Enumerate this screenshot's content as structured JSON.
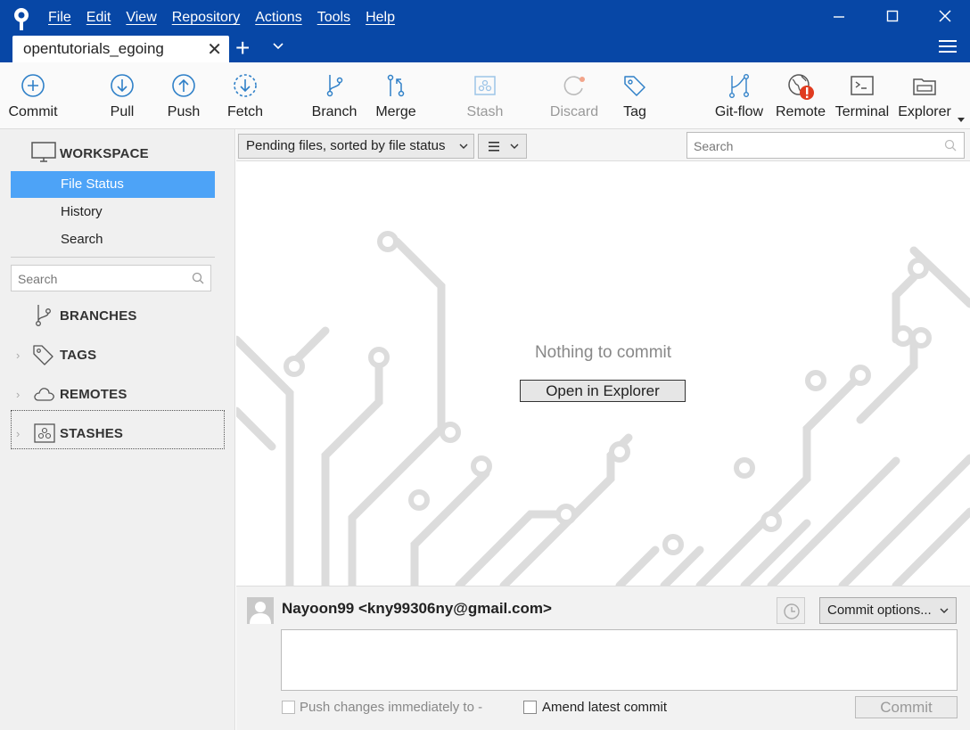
{
  "menu": [
    "File",
    "Edit",
    "View",
    "Repository",
    "Actions",
    "Tools",
    "Help"
  ],
  "window": {
    "minimize": "—",
    "maximize": "☐",
    "close": "✕"
  },
  "tab": {
    "title": "opentutorials_egoing",
    "close": "✕",
    "new": "+"
  },
  "toolbar": {
    "commit": "Commit",
    "pull": "Pull",
    "push": "Push",
    "fetch": "Fetch",
    "branch": "Branch",
    "merge": "Merge",
    "stash": "Stash",
    "discard": "Discard",
    "tag": "Tag",
    "gitflow": "Git-flow",
    "remote": "Remote",
    "terminal": "Terminal",
    "explorer": "Explorer"
  },
  "sidebar": {
    "workspace": "WORKSPACE",
    "items": [
      "File Status",
      "History",
      "Search"
    ],
    "search_placeholder": "Search",
    "branches": "BRANCHES",
    "tags": "TAGS",
    "remotes": "REMOTES",
    "stashes": "STASHES"
  },
  "main": {
    "pending": "Pending files, sorted by file status",
    "search_placeholder": "Search",
    "empty_message": "Nothing to commit",
    "open_explorer": "Open in Explorer"
  },
  "commit_panel": {
    "author": "Nayoon99  <kny99306ny@gmail.com>",
    "options": "Commit options...",
    "push_label": "Push changes immediately to -",
    "amend_label": "Amend latest commit",
    "commit_button": "Commit"
  },
  "colors": {
    "titlebar": "#0747a6",
    "accent": "#4da3f7",
    "icon": "#2f80c8",
    "warning": "#e03b1f"
  }
}
